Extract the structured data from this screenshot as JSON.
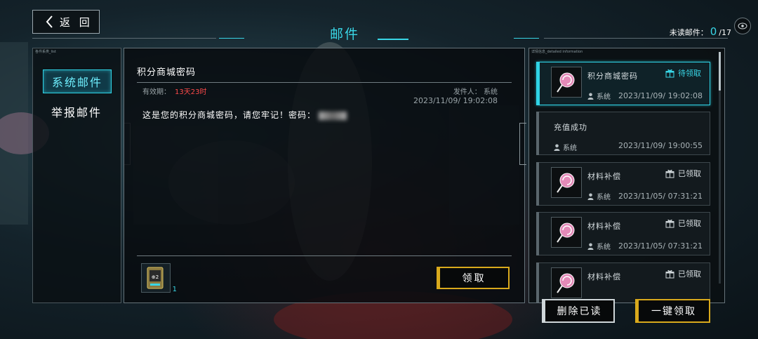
{
  "header": {
    "back_label": "返 回",
    "title": "邮件",
    "unread_label": "未读邮件：",
    "unread_count": "0",
    "unread_total": "/17"
  },
  "left_panel": {
    "caption": "各件系类_list",
    "tabs": [
      {
        "label": "系统邮件",
        "active": true
      },
      {
        "label": "举报邮件",
        "active": false
      }
    ]
  },
  "detail": {
    "title": "积分商城密码",
    "valid_label": "有效期：",
    "valid_value": "13天23时",
    "sender": "发件人： 系统",
    "date": "2023/11/09/ 19:02:08",
    "body": "这是您的积分商城密码，请您牢记！密码：",
    "attachment_count": "1",
    "claim_label": "领取"
  },
  "list_panel": {
    "caption": "详情信息_detailed information",
    "items": [
      {
        "title": "积分商城密码",
        "status": "待领取",
        "claimed": false,
        "sender": "系统",
        "date": "2023/11/09/ 19:02:08",
        "has_thumb": true,
        "selected": true
      },
      {
        "title": "充值成功",
        "status": "",
        "claimed": true,
        "sender": "系统",
        "date": "2023/11/09/ 19:00:55",
        "has_thumb": false,
        "selected": false
      },
      {
        "title": "材料补偿",
        "status": "已领取",
        "claimed": true,
        "sender": "系统",
        "date": "2023/11/05/ 07:31:21",
        "has_thumb": true,
        "selected": false
      },
      {
        "title": "材料补偿",
        "status": "已领取",
        "claimed": true,
        "sender": "系统",
        "date": "2023/11/05/ 07:31:21",
        "has_thumb": true,
        "selected": false
      },
      {
        "title": "材料补偿",
        "status": "已领取",
        "claimed": true,
        "sender": "系统",
        "date": "",
        "has_thumb": true,
        "selected": false
      }
    ]
  },
  "footer": {
    "delete_read_label": "删除已读",
    "claim_all_label": "一键领取"
  },
  "colors": {
    "accent_cyan": "#39d6e6",
    "accent_gold": "#d9a91c",
    "expiry_red": "#ff4a4a"
  },
  "icons": [
    "back-chevron-icon",
    "eye-icon",
    "gift-icon",
    "person-icon",
    "lollipop-icon",
    "item-card-icon"
  ]
}
